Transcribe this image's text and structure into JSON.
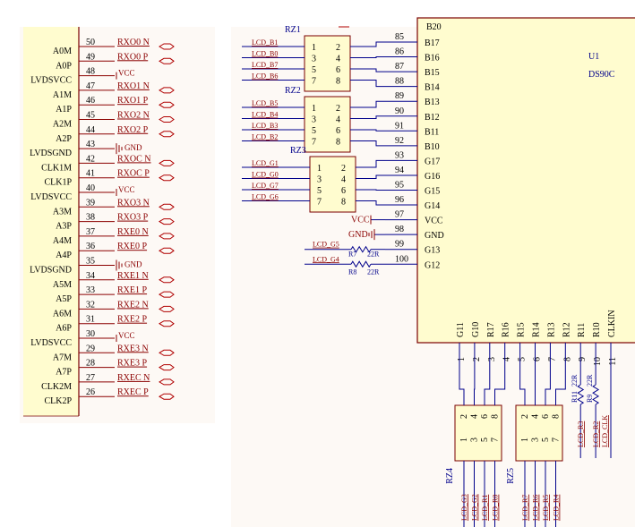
{
  "left_connector": {
    "pins": [
      {
        "num": "50",
        "name": "A0M",
        "net": "RXO0_N",
        "kind": "flag"
      },
      {
        "num": "49",
        "name": "A0P",
        "net": "RXO0_P",
        "kind": "flag"
      },
      {
        "num": "48",
        "name": "LVDSVCC",
        "net": "VCC",
        "kind": "vcc"
      },
      {
        "num": "47",
        "name": "A1M",
        "net": "RXO1_N",
        "kind": "flag"
      },
      {
        "num": "46",
        "name": "A1P",
        "net": "RXO1_P",
        "kind": "flag"
      },
      {
        "num": "45",
        "name": "A2M",
        "net": "RXO2_N",
        "kind": "flag"
      },
      {
        "num": "44",
        "name": "A2P",
        "net": "RXO2_P",
        "kind": "flag"
      },
      {
        "num": "43",
        "name": "LVDSGND",
        "net": "GND",
        "kind": "gnd"
      },
      {
        "num": "42",
        "name": "CLK1M",
        "net": "RXOC_N",
        "kind": "flag"
      },
      {
        "num": "41",
        "name": "CLK1P",
        "net": "RXOC_P",
        "kind": "flag"
      },
      {
        "num": "40",
        "name": "LVDSVCC",
        "net": "VCC",
        "kind": "vcc"
      },
      {
        "num": "39",
        "name": "A3M",
        "net": "RXO3_N",
        "kind": "flag"
      },
      {
        "num": "38",
        "name": "A3P",
        "net": "RXO3_P",
        "kind": "flag"
      },
      {
        "num": "37",
        "name": "A4M",
        "net": "RXE0_N",
        "kind": "flag"
      },
      {
        "num": "36",
        "name": "A4P",
        "net": "RXE0_P",
        "kind": "flag"
      },
      {
        "num": "35",
        "name": "LVDSGND",
        "net": "GND",
        "kind": "gnd"
      },
      {
        "num": "34",
        "name": "A5M",
        "net": "RXE1_N",
        "kind": "flag"
      },
      {
        "num": "33",
        "name": "A5P",
        "net": "RXE1_P",
        "kind": "flag"
      },
      {
        "num": "32",
        "name": "A6M",
        "net": "RXE2_N",
        "kind": "flag"
      },
      {
        "num": "31",
        "name": "A6P",
        "net": "RXE2_P",
        "kind": "flag"
      },
      {
        "num": "30",
        "name": "LVDSVCC",
        "net": "VCC",
        "kind": "vcc"
      },
      {
        "num": "29",
        "name": "A7M",
        "net": "RXE3_N",
        "kind": "flag"
      },
      {
        "num": "28",
        "name": "A7P",
        "net": "RXE3_P",
        "kind": "flag"
      },
      {
        "num": "27",
        "name": "CLK2M",
        "net": "RXEC_N",
        "kind": "flag"
      },
      {
        "num": "26",
        "name": "CLK2P",
        "net": "RXEC_P",
        "kind": "flag"
      }
    ]
  },
  "chip": {
    "ref": "U1",
    "part": "DS90C",
    "partial_top_pin": "B20",
    "right_pins": [
      {
        "num": "85",
        "name": "B17"
      },
      {
        "num": "86",
        "name": "B16"
      },
      {
        "num": "87",
        "name": "B15"
      },
      {
        "num": "88",
        "name": "B14"
      },
      {
        "num": "89",
        "name": "B13"
      },
      {
        "num": "90",
        "name": "B12"
      },
      {
        "num": "91",
        "name": "B11"
      },
      {
        "num": "92",
        "name": "B10"
      },
      {
        "num": "93",
        "name": "G17"
      },
      {
        "num": "94",
        "name": "G16"
      },
      {
        "num": "95",
        "name": "G15"
      },
      {
        "num": "96",
        "name": "G14"
      },
      {
        "num": "97",
        "name": "VCC"
      },
      {
        "num": "98",
        "name": "GND"
      },
      {
        "num": "99",
        "name": "G13"
      },
      {
        "num": "100",
        "name": "G12"
      }
    ],
    "bottom_pins": [
      {
        "num": "1",
        "name": "G11"
      },
      {
        "num": "2",
        "name": "G10"
      },
      {
        "num": "3",
        "name": "R17"
      },
      {
        "num": "4",
        "name": "R16"
      },
      {
        "num": "5",
        "name": "R15"
      },
      {
        "num": "6",
        "name": "R14"
      },
      {
        "num": "7",
        "name": "R13"
      },
      {
        "num": "8",
        "name": "R12"
      },
      {
        "num": "9",
        "name": "R11"
      },
      {
        "num": "10",
        "name": "R10"
      },
      {
        "num": "11",
        "name": "CLKIN"
      }
    ]
  },
  "resistor_networks": [
    {
      "ref": "RZ1",
      "nets": [
        "LCD_B1",
        "LCD_B0",
        "LCD_B7",
        "LCD_B6"
      ],
      "pins": [
        [
          "1",
          "2"
        ],
        [
          "3",
          "4"
        ],
        [
          "5",
          "6"
        ],
        [
          "7",
          "8"
        ]
      ]
    },
    {
      "ref": "RZ2",
      "nets": [
        "LCD_B5",
        "LCD_B4",
        "LCD_B3",
        "LCD_B2"
      ],
      "pins": [
        [
          "1",
          "2"
        ],
        [
          "3",
          "4"
        ],
        [
          "5",
          "6"
        ],
        [
          "7",
          "8"
        ]
      ]
    },
    {
      "ref": "RZ3",
      "nets": [
        "LCD_G1",
        "LCD_G0",
        "LCD_G7",
        "LCD_G6"
      ],
      "pins": [
        [
          "1",
          "2"
        ],
        [
          "3",
          "4"
        ],
        [
          "5",
          "6"
        ],
        [
          "7",
          "8"
        ]
      ]
    },
    {
      "ref": "RZ4",
      "nets": [
        "LCD_G3",
        "LCD_G2",
        "LCD_R1",
        "LCD_R0"
      ],
      "top_pins": [
        "2",
        "4",
        "6",
        "8"
      ],
      "bottom_pins": [
        "1",
        "3",
        "5",
        "7"
      ]
    },
    {
      "ref": "RZ5",
      "nets": [
        "LCD_R7",
        "LCD_R6",
        "LCD_R5",
        "LCD_R4"
      ],
      "top_pins": [
        "2",
        "4",
        "6",
        "8"
      ],
      "bottom_pins": [
        "1",
        "3",
        "5",
        "7"
      ]
    }
  ],
  "resistors": [
    {
      "ref": "R7",
      "value": "22R",
      "net": "LCD_G5"
    },
    {
      "ref": "R8",
      "value": "22R",
      "net": "LCD_G4"
    },
    {
      "ref": "R11",
      "value": "22R",
      "net": "LCD_R3"
    },
    {
      "ref": "R9",
      "value": "22R",
      "net": "LCD_R2"
    }
  ],
  "extra_nets": {
    "clk": "LCD_CLK"
  },
  "power": {
    "vcc": "VCC",
    "gnd": "GND"
  },
  "colors": {
    "body": "#fffccf",
    "bg": "#fdf9f5",
    "wire": "#00008b",
    "red": "#b00000",
    "label_red": "#8b0000",
    "text": "#000000",
    "bodyline": "#7a0000"
  }
}
